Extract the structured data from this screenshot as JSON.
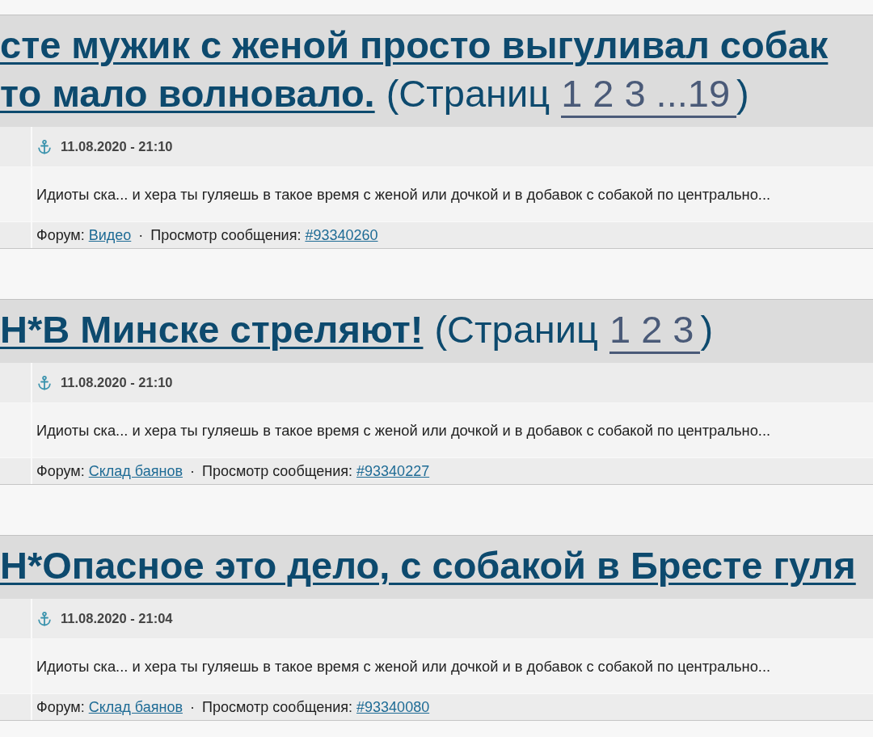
{
  "results": [
    {
      "title_lines": [
        "сте мужик с женой просто выгуливал собак",
        "то мало волновало."
      ],
      "pages_label": "(Страниц",
      "pages": [
        "1",
        "2",
        "3",
        "...19"
      ],
      "pages_close": ")",
      "date": "11.08.2020 - 21:10",
      "excerpt": "Идиоты ска... и хера ты гуляешь в такое время с женой или дочкой и в добавок с собакой по центрально...",
      "forum_label": "Форум:",
      "forum": "Видео",
      "separator": "·",
      "view_label": "Просмотр сообщения:",
      "post_link": "#93340260"
    },
    {
      "title_lines": [
        "Н*В Минске стреляют!"
      ],
      "pages_label": "(Страниц",
      "pages": [
        "1",
        "2",
        "3"
      ],
      "pages_close": ")",
      "date": "11.08.2020 - 21:10",
      "excerpt": "Идиоты ска... и хера ты гуляешь в такое время с женой или дочкой и в добавок с собакой по центрально...",
      "forum_label": "Форум:",
      "forum": "Склад баянов",
      "separator": "·",
      "view_label": "Просмотр сообщения:",
      "post_link": "#93340227"
    },
    {
      "title_lines": [
        "Н*Опасное это дело, с собакой в Бресте гуля"
      ],
      "date": "11.08.2020 - 21:04",
      "excerpt": "Идиоты ска... и хера ты гуляешь в такое время с женой или дочкой и в добавок с собакой по центрально...",
      "forum_label": "Форум:",
      "forum": "Склад баянов",
      "separator": "·",
      "view_label": "Просмотр сообщения:",
      "post_link": "#93340080"
    }
  ]
}
